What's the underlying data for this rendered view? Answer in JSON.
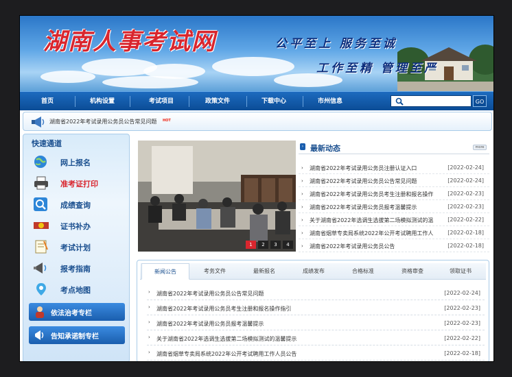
{
  "banner": {
    "site_title": "湖南人事考试网",
    "slogan_1": "公平至上 服务至诚",
    "slogan_2": "工作至精 管理至严"
  },
  "nav": {
    "items": [
      {
        "label": "首页"
      },
      {
        "label": "机构设置"
      },
      {
        "label": "考试项目"
      },
      {
        "label": "政策文件"
      },
      {
        "label": "下载中心"
      },
      {
        "label": "市州信息"
      }
    ],
    "search_placeholder": "",
    "go_label": "GO"
  },
  "announcement": {
    "text": "湖南省2022年考试录用公务员公告常见问题",
    "badge": "HOT"
  },
  "sidebar": {
    "title": "快速通道",
    "items": [
      {
        "label": "网上报名",
        "icon": "globe-icon"
      },
      {
        "label": "准考证打印",
        "icon": "printer-icon"
      },
      {
        "label": "成绩查询",
        "icon": "magnifier-icon"
      },
      {
        "label": "证书补办",
        "icon": "certificate-icon"
      },
      {
        "label": "考试计划",
        "icon": "notepad-icon"
      },
      {
        "label": "报考指南",
        "icon": "megaphone-icon"
      },
      {
        "label": "考点地图",
        "icon": "map-pin-icon"
      }
    ],
    "buttons": [
      {
        "label": "依法治考专栏"
      },
      {
        "label": "告知承诺制专栏"
      }
    ]
  },
  "slideshow": {
    "pages": [
      "1",
      "2",
      "3",
      "4"
    ],
    "active_page": "1"
  },
  "latest_news": {
    "title": "最新动态",
    "more_label": "more",
    "items": [
      {
        "title": "湖南省2022年考试录用公务员注册认证入口",
        "date": "[2022-02-24]"
      },
      {
        "title": "湖南省2022年考试录用公务员公告常见问题",
        "date": "[2022-02-24]"
      },
      {
        "title": "湖南省2022年考试录用公务员考生注册和报名操作",
        "date": "[2022-02-23]"
      },
      {
        "title": "湖南省2022年考试录用公务员报考温馨提示",
        "date": "[2022-02-23]"
      },
      {
        "title": "关于湖南省2022年选调生选拔第二场模拟测试的温",
        "date": "[2022-02-22]"
      },
      {
        "title": "湖南省烟草专卖局系统2022年公开考试聘用工作人",
        "date": "[2022-02-18]"
      },
      {
        "title": "湖南省2022年考试录用公务员公告",
        "date": "[2022-02-18]"
      }
    ]
  },
  "tabs": {
    "items": [
      {
        "label": "新闻公告"
      },
      {
        "label": "考务文件"
      },
      {
        "label": "最新报名"
      },
      {
        "label": "成绩发布"
      },
      {
        "label": "合格标准"
      },
      {
        "label": "资格审查"
      },
      {
        "label": "领取证书"
      }
    ],
    "rows": [
      {
        "title": "湖南省2022年考试录用公务员公告常见问题",
        "date": "[2022-02-24]"
      },
      {
        "title": "湖南省2022年考试录用公务员考生注册和报名操作指引",
        "date": "[2022-02-23]"
      },
      {
        "title": "湖南省2022年考试录用公务员报考温馨提示",
        "date": "[2022-02-23]"
      },
      {
        "title": "关于湖南省2022年选调生选拔第二场模拟测试的温馨提示",
        "date": "[2022-02-22]"
      },
      {
        "title": "湖南省烟草专卖局系统2022年公开考试聘用工作人员公告",
        "date": "[2022-02-18]"
      }
    ]
  }
}
